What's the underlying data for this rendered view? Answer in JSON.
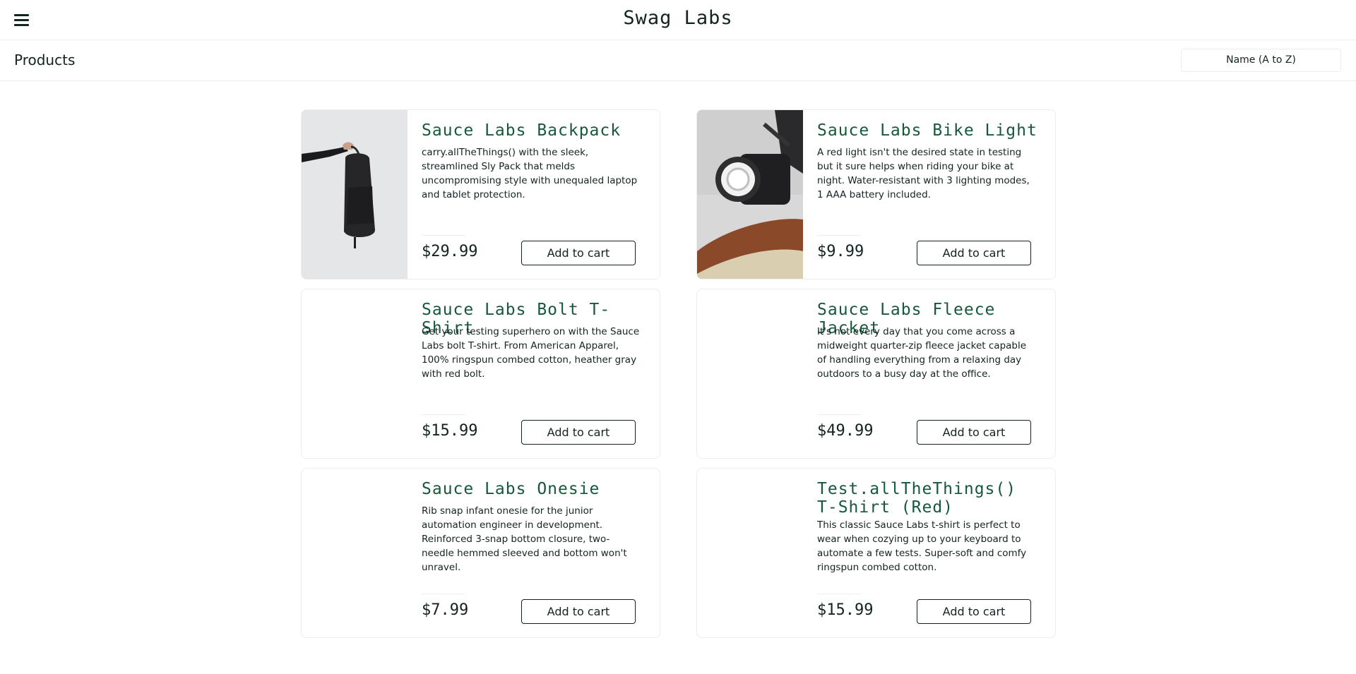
{
  "header": {
    "logo": "Swag Labs"
  },
  "subheader": {
    "title": "Products",
    "sort_selected": "Name (A to Z)"
  },
  "products": [
    {
      "name": "Sauce Labs Backpack",
      "description": "carry.allTheThings() with the sleek, streamlined Sly Pack that melds uncompromising style with unequaled laptop and tablet protection.",
      "price": "$29.99",
      "button": "Add to cart"
    },
    {
      "name": "Sauce Labs Bike Light",
      "description": "A red light isn't the desired state in testing but it sure helps when riding your bike at night. Water-resistant with 3 lighting modes, 1 AAA battery included.",
      "price": "$9.99",
      "button": "Add to cart"
    },
    {
      "name": "Sauce Labs Bolt T-Shirt",
      "description": "Get your testing superhero on with the Sauce Labs bolt T-shirt. From American Apparel, 100% ringspun combed cotton, heather gray with red bolt.",
      "price": "$15.99",
      "button": "Add to cart"
    },
    {
      "name": "Sauce Labs Fleece Jacket",
      "description": "It's not every day that you come across a midweight quarter-zip fleece jacket capable of handling everything from a relaxing day outdoors to a busy day at the office.",
      "price": "$49.99",
      "button": "Add to cart"
    },
    {
      "name": "Sauce Labs Onesie",
      "description": "Rib snap infant onesie for the junior automation engineer in development. Reinforced 3-snap bottom closure, two-needle hemmed sleeved and bottom won't unravel.",
      "price": "$7.99",
      "button": "Add to cart"
    },
    {
      "name": "Test.allTheThings() T-Shirt (Red)",
      "description": "This classic Sauce Labs t-shirt is perfect to wear when cozying up to your keyboard to automate a few tests. Super-soft and comfy ringspun combed cotton.",
      "price": "$15.99",
      "button": "Add to cart"
    }
  ]
}
